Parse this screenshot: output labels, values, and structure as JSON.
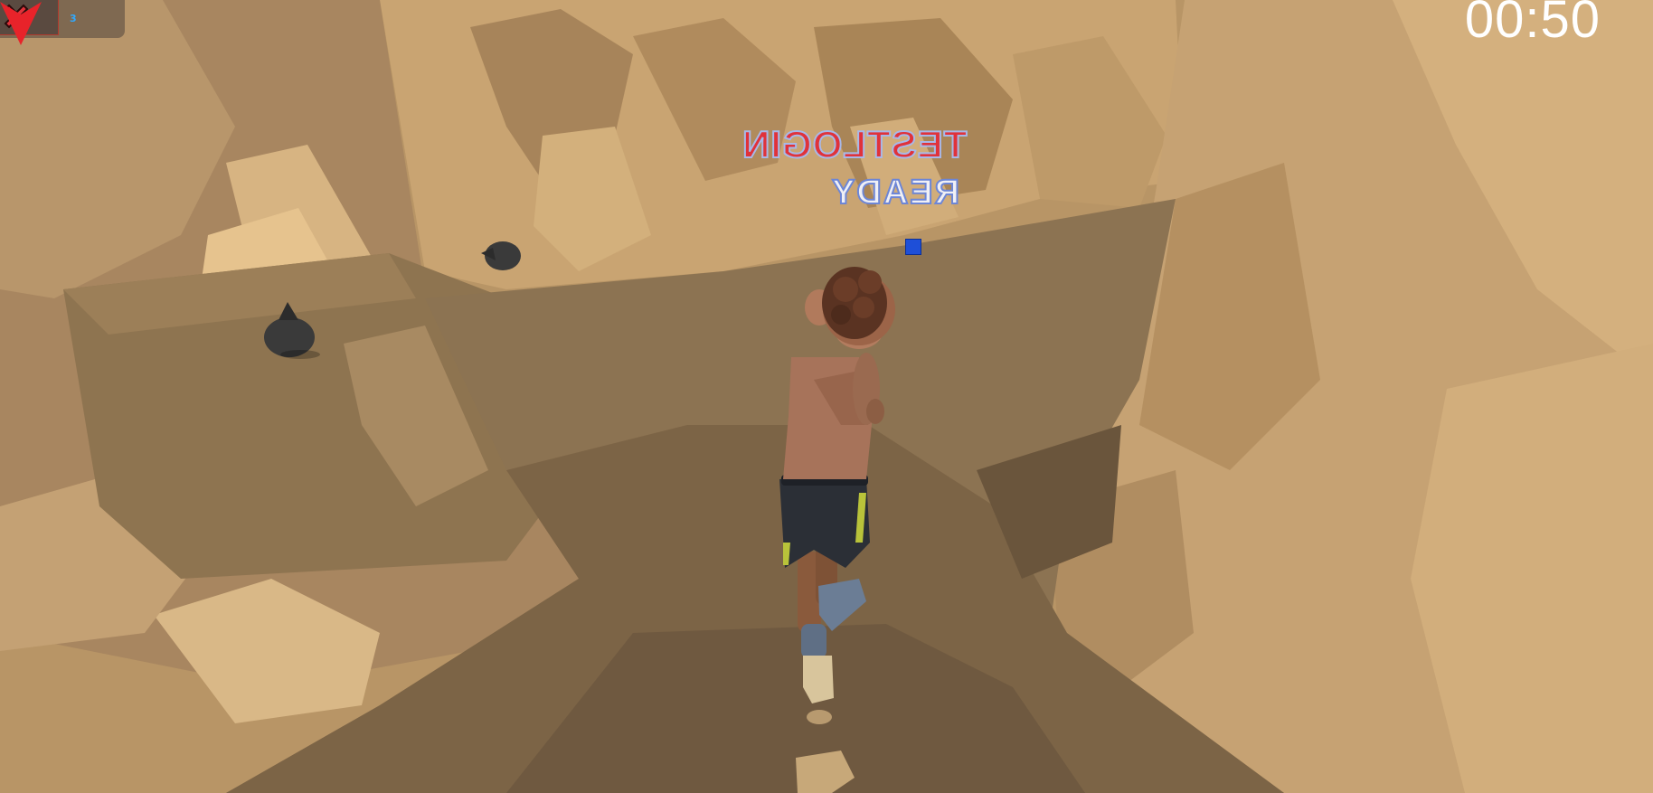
{
  "hud": {
    "player_count": "3",
    "timer": "00:50"
  },
  "overhead": {
    "player_name": "TESTLOGIN",
    "status": "READY",
    "not_ready_icon": "red-x-icon",
    "player_marker_icon": "red-arrow-marker",
    "team_indicator_color": "#1e4fd8"
  },
  "scene": {
    "objects": [
      "garbage-bag",
      "garbage-bag",
      "player-character"
    ]
  }
}
